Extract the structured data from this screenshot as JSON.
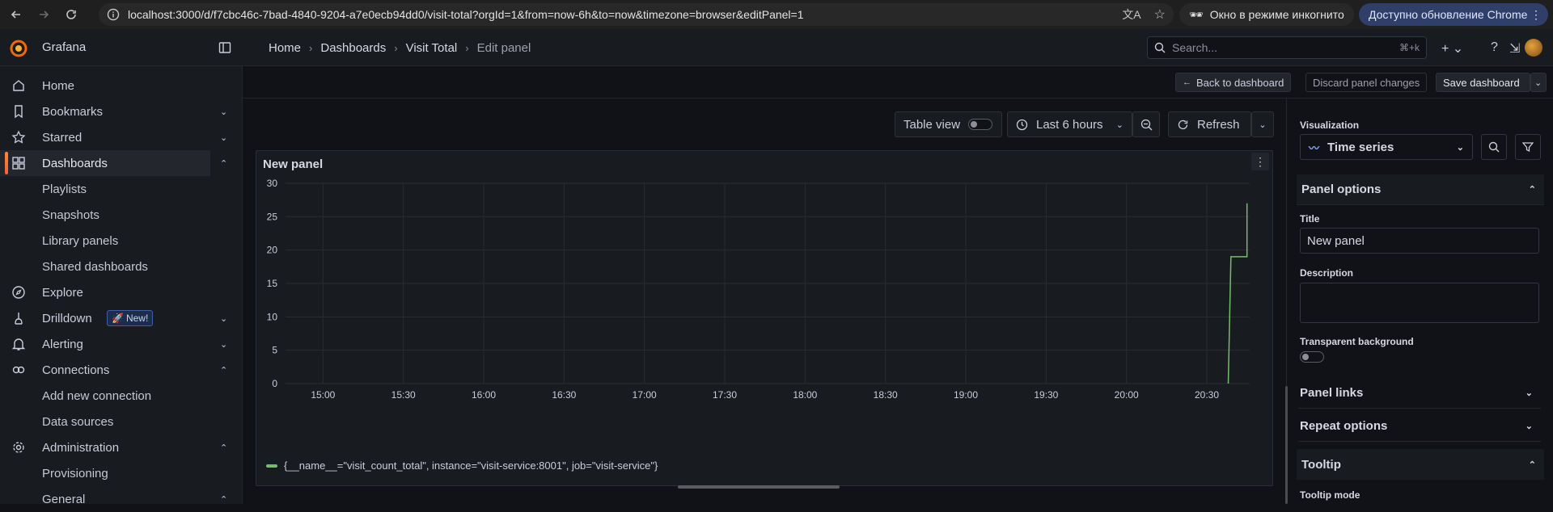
{
  "browser": {
    "url": "localhost:3000/d/f7cbc46c-7bad-4840-9204-a7e0ecb94dd0/visit-total?orgId=1&from=now-6h&to=now&timezone=browser&editPanel=1",
    "incognito_label": "Окно в режиме инкогнито",
    "update_label": "Доступно обновление Chrome"
  },
  "app": {
    "brand": "Grafana",
    "search_placeholder": "Search...",
    "search_shortcut": "⌘+k"
  },
  "breadcrumb": [
    "Home",
    "Dashboards",
    "Visit Total",
    "Edit panel"
  ],
  "sidebar": {
    "items": [
      {
        "label": "Home",
        "icon": "home-icon"
      },
      {
        "label": "Bookmarks",
        "icon": "bookmark-icon"
      },
      {
        "label": "Starred",
        "icon": "star-icon"
      },
      {
        "label": "Dashboards",
        "icon": "dashboards-icon"
      },
      {
        "label": "Playlists"
      },
      {
        "label": "Snapshots"
      },
      {
        "label": "Library panels"
      },
      {
        "label": "Shared dashboards"
      },
      {
        "label": "Explore",
        "icon": "compass-icon"
      },
      {
        "label": "Drilldown",
        "icon": "drilldown-icon",
        "badge": "New!"
      },
      {
        "label": "Alerting",
        "icon": "bell-icon"
      },
      {
        "label": "Connections",
        "icon": "connections-icon"
      },
      {
        "label": "Add new connection"
      },
      {
        "label": "Data sources"
      },
      {
        "label": "Administration",
        "icon": "cog-icon"
      },
      {
        "label": "Provisioning"
      },
      {
        "label": "General"
      }
    ]
  },
  "edit_bar": {
    "back_label": "Back to dashboard",
    "discard_label": "Discard panel changes",
    "save_label": "Save dashboard"
  },
  "controls": {
    "table_view_label": "Table view",
    "time_range": "Last 6 hours",
    "refresh_label": "Refresh"
  },
  "panel": {
    "title": "New panel",
    "legend": "{__name__=\"visit_count_total\", instance=\"visit-service:8001\", job=\"visit-service\"}"
  },
  "chart_data": {
    "type": "line",
    "title": "New panel",
    "xlabel": "",
    "ylabel": "",
    "x_ticks": [
      "15:00",
      "15:30",
      "16:00",
      "16:30",
      "17:00",
      "17:30",
      "18:00",
      "18:30",
      "19:00",
      "19:30",
      "20:00",
      "20:30"
    ],
    "y_ticks": [
      0,
      5,
      10,
      15,
      20,
      25,
      30
    ],
    "ylim": [
      0,
      30
    ],
    "xlim": [
      "14:46",
      "20:46"
    ],
    "grid": true,
    "legend_position": "bottom-left",
    "series": [
      {
        "name": "{__name__=\"visit_count_total\", instance=\"visit-service:8001\", job=\"visit-service\"}",
        "color": "#73bf69",
        "x": [
          "20:38",
          "20:39",
          "20:39",
          "20:45",
          "20:45"
        ],
        "y": [
          0,
          19,
          19,
          19,
          27
        ]
      }
    ]
  },
  "options": {
    "visualization_label": "Visualization",
    "visualization_value": "Time series",
    "panel_options_label": "Panel options",
    "title_label": "Title",
    "title_value": "New panel",
    "description_label": "Description",
    "transparent_label": "Transparent background",
    "panel_links_label": "Panel links",
    "repeat_options_label": "Repeat options",
    "tooltip_label": "Tooltip",
    "tooltip_mode_label": "Tooltip mode"
  }
}
